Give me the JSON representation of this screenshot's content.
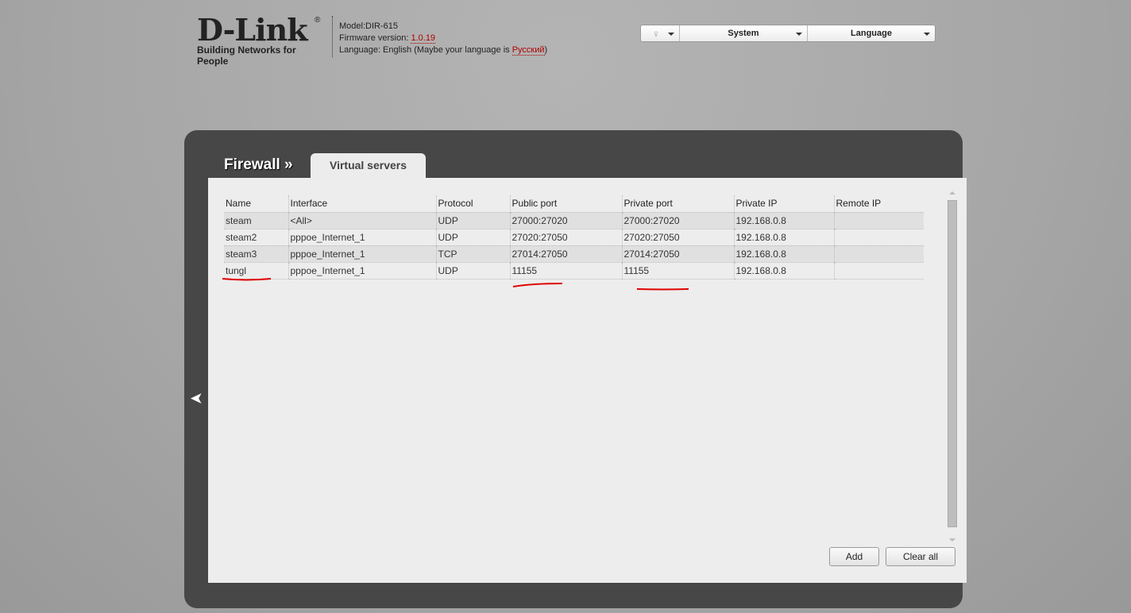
{
  "header": {
    "logo_text": "D-Link",
    "logo_tagline": "Building Networks for People",
    "model": "Model:DIR-615",
    "firmware_label": "Firmware version: ",
    "firmware_value": "1.0.19",
    "language_prefix": "Language: English (Maybe your language is ",
    "language_link": "Русский",
    "language_suffix": ")"
  },
  "topbar": {
    "system": "System",
    "language": "Language"
  },
  "breadcrumb": "Firewall »",
  "tab": "Virtual servers",
  "table": {
    "columns": [
      "Name",
      "Interface",
      "Protocol",
      "Public port",
      "Private port",
      "Private IP",
      "Remote IP"
    ],
    "rows": [
      [
        "steam",
        "<All>",
        "UDP",
        "27000:27020",
        "27000:27020",
        "192.168.0.8",
        ""
      ],
      [
        "steam2",
        "pppoe_Internet_1",
        "UDP",
        "27020:27050",
        "27020:27050",
        "192.168.0.8",
        ""
      ],
      [
        "steam3",
        "pppoe_Internet_1",
        "TCP",
        "27014:27050",
        "27014:27050",
        "192.168.0.8",
        ""
      ],
      [
        "tungl",
        "pppoe_Internet_1",
        "UDP",
        "11155",
        "11155",
        "192.168.0.8",
        ""
      ]
    ]
  },
  "buttons": {
    "add": "Add",
    "clear_all": "Clear all"
  },
  "colors": {
    "annotation": "#e00000",
    "link": "#b00000"
  }
}
